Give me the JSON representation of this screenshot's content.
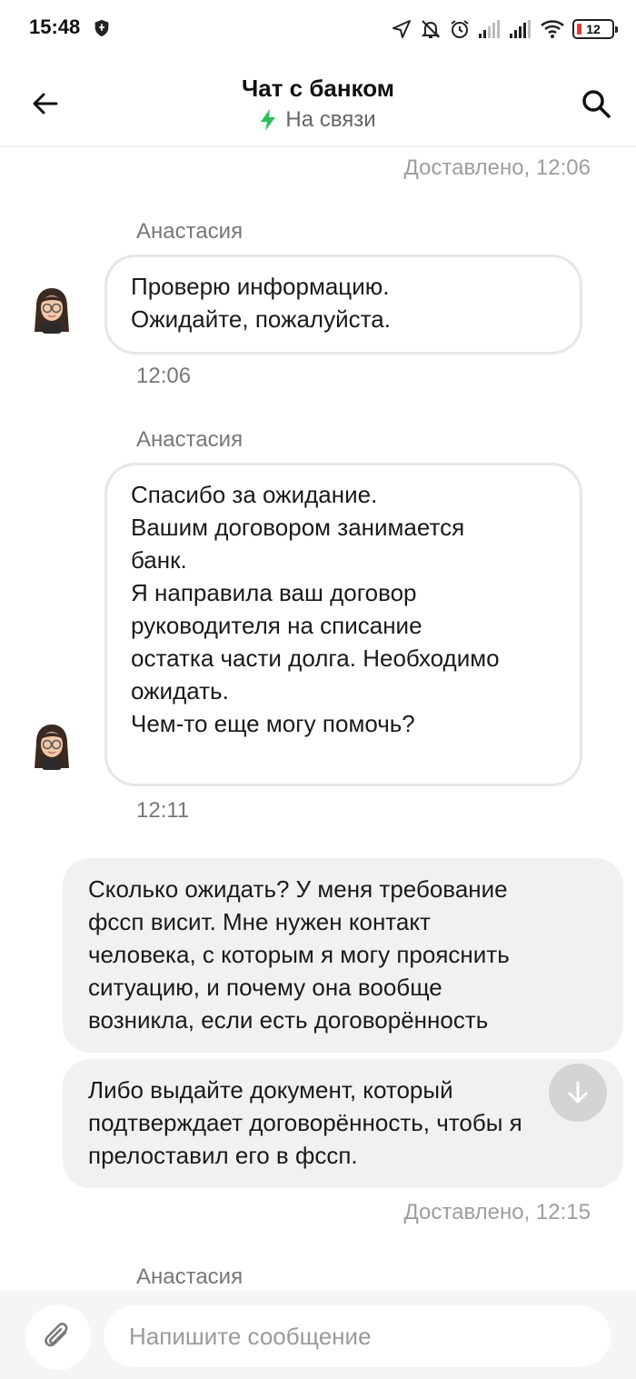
{
  "status_bar": {
    "time": "15:48",
    "battery": "12",
    "icons": [
      "shield-icon",
      "location-icon",
      "bell-off-icon",
      "alarm-icon",
      "signal-icon",
      "signal-icon",
      "wifi-icon",
      "battery-icon"
    ],
    "battery_low_color": "#e53935"
  },
  "header": {
    "title": "Чат с банком",
    "status": "На связи",
    "status_icon": "lightning-icon",
    "status_color": "#2bbf5b",
    "back_icon": "arrow-left-icon",
    "search_icon": "search-icon"
  },
  "messages": {
    "delivered_1": "Доставлено, 12:06",
    "sender_1": "Анастасия",
    "msg_1": {
      "lines": [
        "Проверю информацию.",
        "Ожидайте, пожалуйста."
      ],
      "time": "12:06"
    },
    "sender_2": "Анастасия",
    "msg_2": {
      "lines": [
        "Спасибо за ожидание.",
        "Вашим договором занимается",
        "банк.",
        "Я направила ваш договор",
        "руководителя на списание",
        "остатка части долга. Необходимо",
        "ожидать.",
        "Чем-то еще могу помочь?"
      ],
      "time": "12:11"
    },
    "out_1": {
      "lines": [
        "Сколько ожидать? У меня требование",
        "фссп висит. Мне нужен контакт",
        "человека, с которым я могу прояснить",
        "ситуацию, и почему она вообще",
        "возникла, если есть договорённость"
      ]
    },
    "out_2": {
      "lines": [
        "Либо выдайте документ, который",
        "подтверждает договорённость, чтобы я",
        "прелоставил его в фссп."
      ]
    },
    "delivered_2": "Доставлено, 12:15",
    "sender_3": "Анастасия"
  },
  "composer": {
    "placeholder": "Напишите сообщение",
    "attach_icon": "paperclip-icon",
    "scroll_icon": "arrow-down-icon"
  }
}
